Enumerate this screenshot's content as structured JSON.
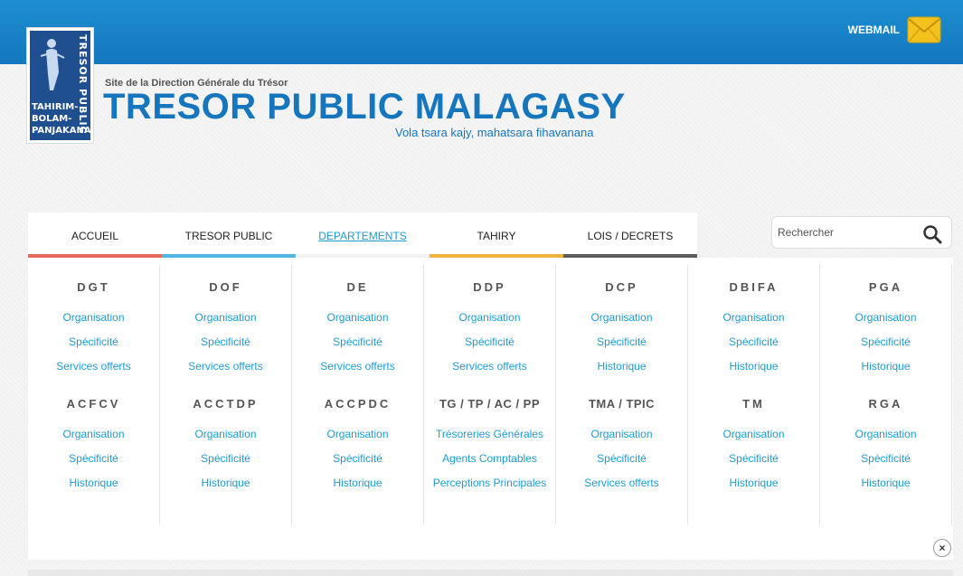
{
  "header": {
    "webmail_label": "WEBMAIL",
    "site_label": "Site de la Direction Générale du Trésor",
    "site_title": "TRESOR PUBLIC MALAGASY",
    "slogan": "Vola tsara kajy, mahatsara fihavanana",
    "logo_text_vertical": "TRESOR PUBLIC",
    "logo_text_lines": [
      "TAHIRIM-",
      "BOLAM-",
      "PANJAKANA"
    ]
  },
  "nav": {
    "items": [
      {
        "label": "ACCUEIL",
        "color": "#e8685a"
      },
      {
        "label": "TRESOR PUBLIC",
        "color": "#4fb6e6"
      },
      {
        "label": "DEPARTEMENTS",
        "color": "#f3f3f3"
      },
      {
        "label": "TAHIRY",
        "color": "#f0b43a"
      },
      {
        "label": "LOIS / DECRETS",
        "color": "#5d5d5d"
      }
    ]
  },
  "search": {
    "placeholder": "Rechercher"
  },
  "menu": {
    "columns": [
      {
        "groups": [
          {
            "title": "DGT",
            "links": [
              "Organisation",
              "Spécificité",
              "Services offerts"
            ]
          },
          {
            "title": "ACFCV",
            "links": [
              "Organisation",
              "Spécificité",
              "Historique"
            ]
          }
        ]
      },
      {
        "groups": [
          {
            "title": "DOF",
            "links": [
              "Organisation",
              "Spécificité",
              "Services offerts"
            ]
          },
          {
            "title": "ACCTDP",
            "links": [
              "Organisation",
              "Spécificité",
              "Historique"
            ]
          }
        ]
      },
      {
        "groups": [
          {
            "title": "DE",
            "links": [
              "Organisation",
              "Spécificité",
              "Services offerts"
            ]
          },
          {
            "title": "ACCPDC",
            "links": [
              "Organisation",
              "Spécificité",
              "Historique"
            ]
          }
        ]
      },
      {
        "groups": [
          {
            "title": "DDP",
            "links": [
              "Organisation",
              "Spécificité",
              "Services offerts"
            ]
          },
          {
            "title": "TG / TP / AC / PP",
            "links": [
              "Trésoreries Générales",
              "Agents Comptables",
              "Perceptions Principales"
            ]
          }
        ]
      },
      {
        "groups": [
          {
            "title": "DCP",
            "links": [
              "Organisation",
              "Spécificité",
              "Historique"
            ]
          },
          {
            "title": "TMA / TPIC",
            "links": [
              "Organisation",
              "Spécificité",
              "Services offerts"
            ]
          }
        ]
      },
      {
        "groups": [
          {
            "title": "DBIFA",
            "links": [
              "Organisation",
              "Spécificité",
              "Historique"
            ]
          },
          {
            "title": "TM",
            "links": [
              "Organisation",
              "Spécificité",
              "Historique"
            ]
          }
        ]
      },
      {
        "groups": [
          {
            "title": "PGA",
            "links": [
              "Organisation",
              "Spécificité",
              "Historique"
            ]
          },
          {
            "title": "RGA",
            "links": [
              "Organisation",
              "Spécificité",
              "Historique"
            ]
          }
        ]
      }
    ]
  },
  "close_label": "×"
}
